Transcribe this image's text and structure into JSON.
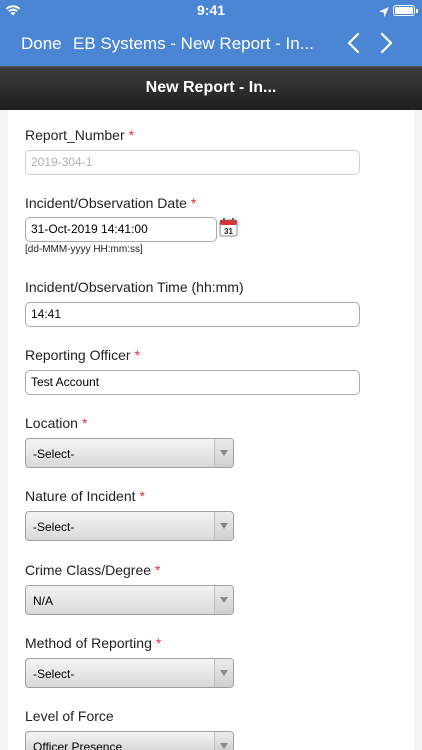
{
  "status_bar": {
    "time": "9:41",
    "icons": [
      "wifi-icon",
      "location-icon",
      "battery-icon"
    ]
  },
  "nav": {
    "done_label": "Done",
    "title": "EB Systems - New Report - In...",
    "icons": [
      "chevron-left-icon",
      "chevron-right-icon"
    ]
  },
  "header": {
    "title": "New Report - In..."
  },
  "colors": {
    "nav_blue": "#4a86d4",
    "header_dark": "#2a2a2a",
    "required_red": "#e03030"
  },
  "form": {
    "report_number": {
      "label": "Report_Number",
      "required": "*",
      "value": "2019-304-1"
    },
    "incident_date": {
      "label": "Incident/Observation Date",
      "required": "*",
      "value": "31-Oct-2019 14:41:00",
      "hint": "[dd-MMM-yyyy HH:mm:ss]",
      "icon": "calendar-icon"
    },
    "incident_time": {
      "label": "Incident/Observation Time (hh:mm)",
      "value": "14:41"
    },
    "reporting_officer": {
      "label": "Reporting Officer",
      "required": "*",
      "value": "Test Account"
    },
    "location": {
      "label": "Location",
      "required": "*",
      "selected": "-Select-"
    },
    "nature_of_incident": {
      "label": "Nature of Incident",
      "required": "*",
      "selected": "-Select-"
    },
    "crime_class": {
      "label": "Crime Class/Degree",
      "required": "*",
      "selected": "N/A"
    },
    "method_of_reporting": {
      "label": "Method of Reporting",
      "required": "*",
      "selected": "-Select-"
    },
    "level_of_force": {
      "label": "Level of Force",
      "selected": "Officer Presence"
    }
  }
}
